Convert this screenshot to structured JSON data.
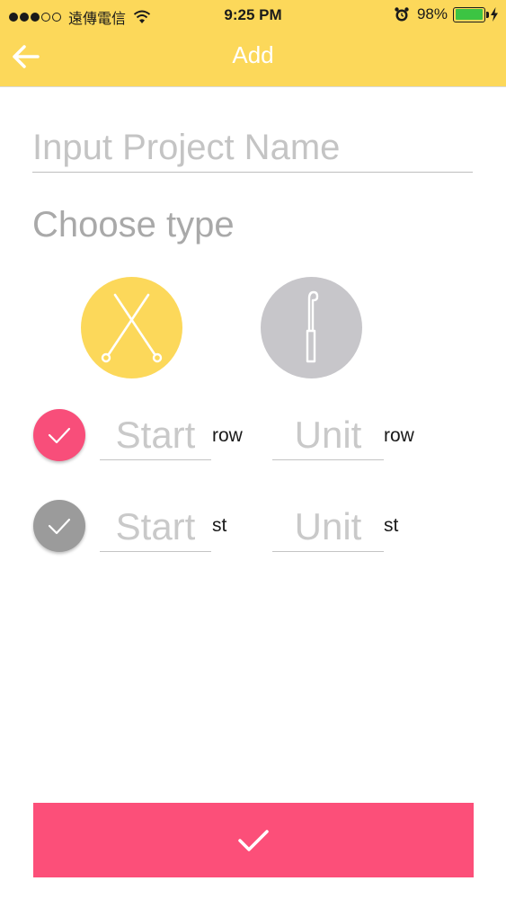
{
  "status_bar": {
    "carrier": "遠傳電信",
    "time": "9:25 PM",
    "battery_percent": "98%",
    "battery_level": 0.98,
    "signal_bars_filled": 3,
    "signal_bars_total": 5
  },
  "header": {
    "title": "Add",
    "back_icon": "arrow-left-icon",
    "background_color": "#fcd85a"
  },
  "form": {
    "project_name": {
      "value": "",
      "placeholder": "Input Project Name"
    },
    "choose_type_label": "Choose type",
    "types": [
      {
        "icon": "knitting-needles-icon",
        "selected": true,
        "color": "#fcd85a"
      },
      {
        "icon": "crochet-hook-icon",
        "selected": false,
        "color": "#c7c6ca"
      }
    ],
    "counters": [
      {
        "enabled": true,
        "check_color": "#f84e7a",
        "start_placeholder": "Start",
        "start_value": "",
        "start_unit": "row",
        "unit_placeholder": "Unit",
        "unit_value": "",
        "unit_unit": "row"
      },
      {
        "enabled": false,
        "check_color": "#9b9b9b",
        "start_placeholder": "Start",
        "start_value": "",
        "start_unit": "st",
        "unit_placeholder": "Unit",
        "unit_value": "",
        "unit_unit": "st"
      }
    ]
  },
  "confirm": {
    "icon": "checkmark-icon",
    "color": "#fc4f79"
  }
}
